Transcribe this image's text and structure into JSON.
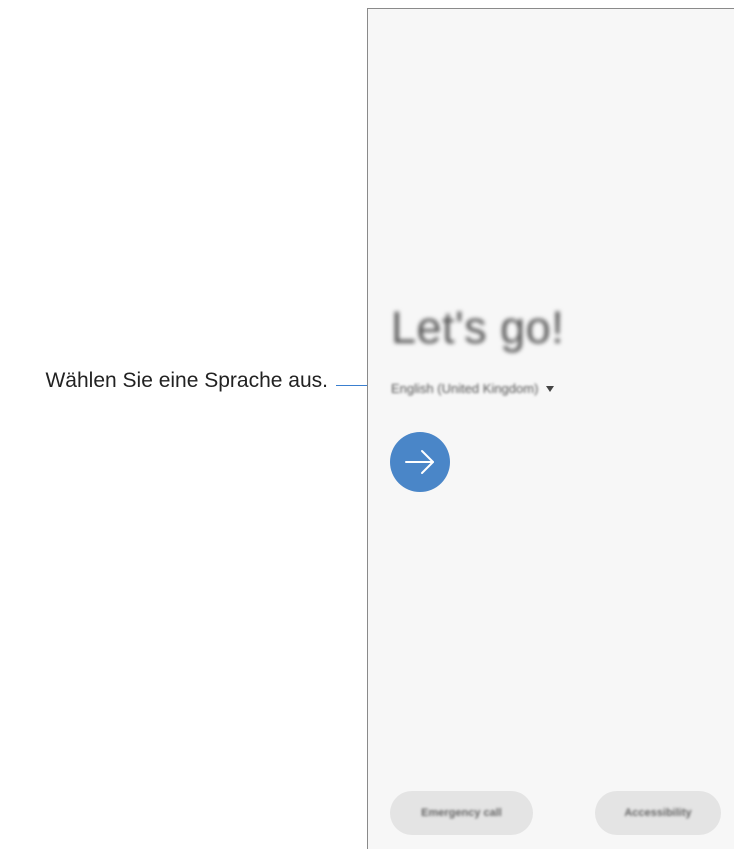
{
  "annotation": {
    "label": "Wählen Sie eine Sprache aus.",
    "line_color": "#3a7fcf"
  },
  "screen": {
    "headline": "Let's go!",
    "language_selector": {
      "value": "English (United Kingdom)",
      "icon": "dropdown-arrow-icon"
    },
    "next_button": {
      "icon": "arrow-right-icon",
      "color": "#4a86c8"
    },
    "bottom_buttons": {
      "emergency_call": "Emergency call",
      "accessibility": "Accessibility"
    }
  }
}
